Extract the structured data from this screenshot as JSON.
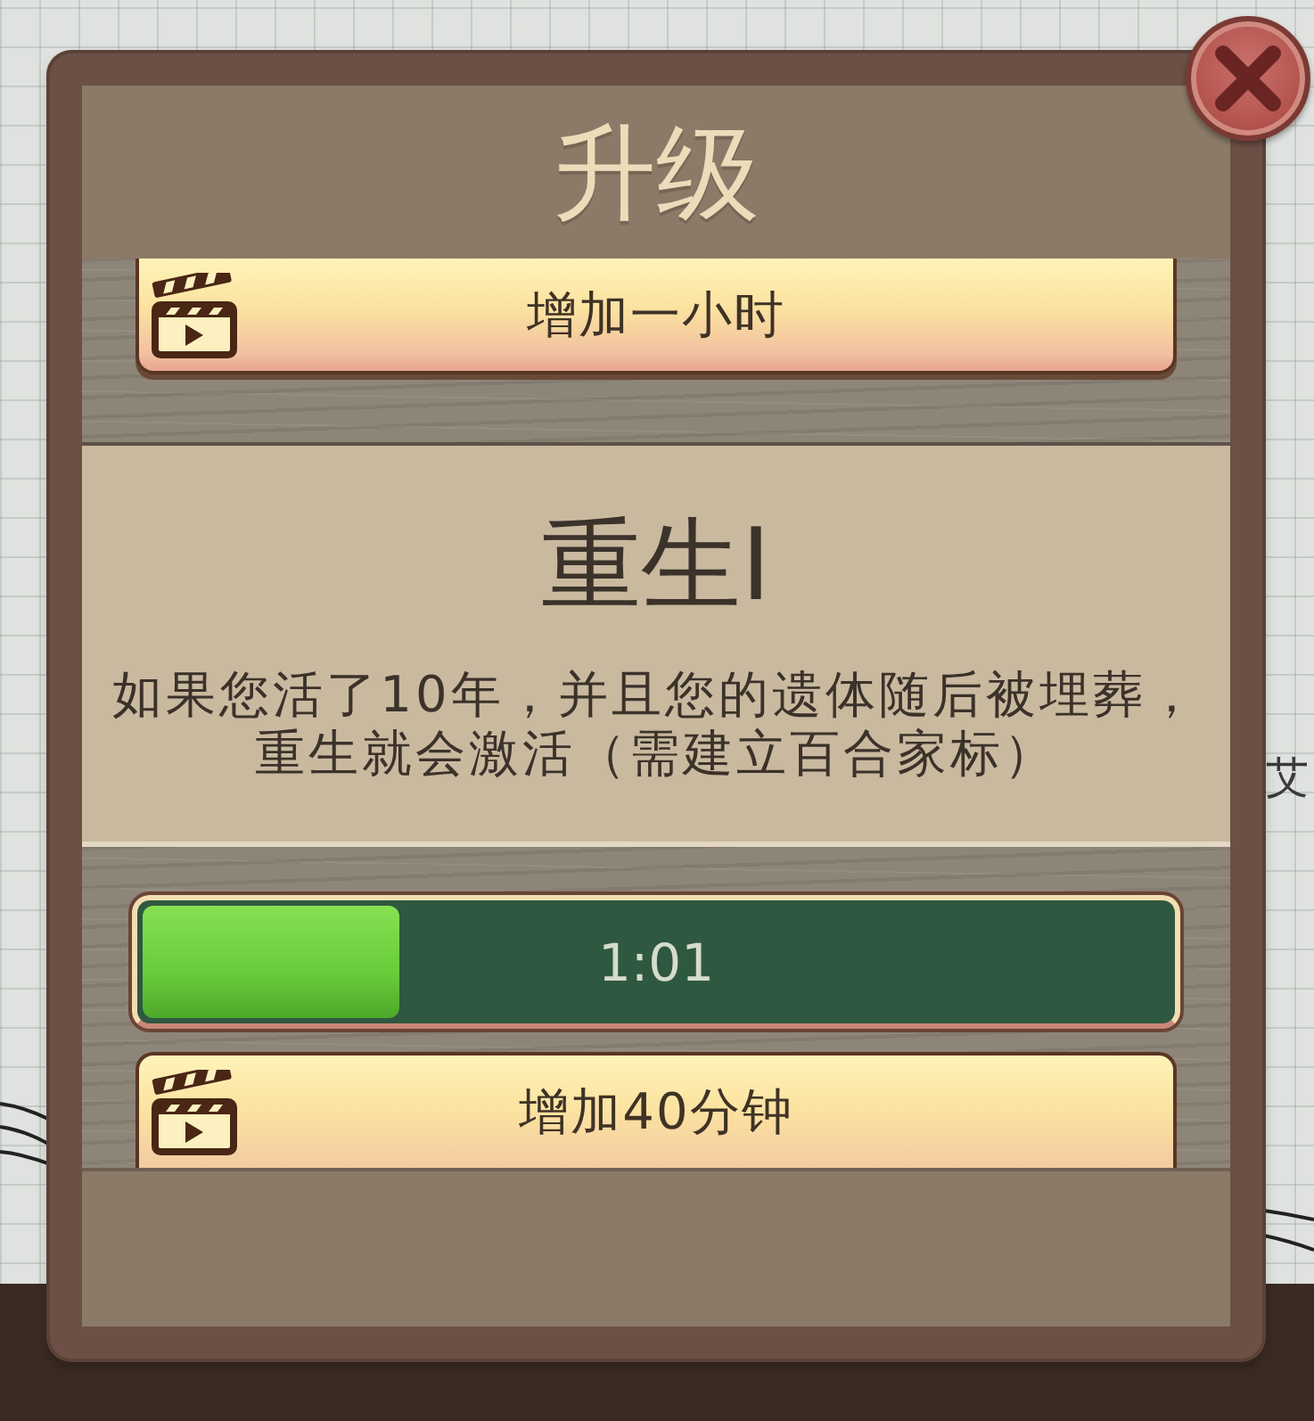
{
  "background_text": [
    "艾"
  ],
  "dialog": {
    "title": "升级",
    "sections": [
      {
        "kind": "actions",
        "buttons": [
          {
            "label": "增加一小时"
          }
        ]
      },
      {
        "kind": "perk",
        "title": "重生I",
        "description": "如果您活了10年，并且您的遗体随后被埋葬，重生就会激活（需建立百合家标）"
      },
      {
        "kind": "actions",
        "progress": {
          "level": 0.25,
          "reading": "1:01"
        },
        "buttons": [
          {
            "label": "增加40分钟"
          }
        ]
      }
    ]
  }
}
